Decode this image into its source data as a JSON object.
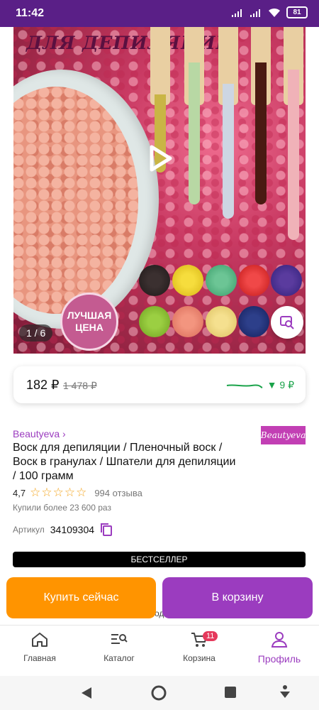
{
  "status_bar": {
    "time": "11:42",
    "battery": "81"
  },
  "hero": {
    "title": "ДЛЯ ДЕПИЛЯЦИИ",
    "counter": "1 / 6",
    "badge_line1": "ЛУЧШАЯ",
    "badge_line2": "ЦЕНА"
  },
  "price": {
    "current": "182 ₽",
    "old": "1 478 ₽",
    "change": "▼ 9 ₽"
  },
  "product": {
    "brand": "Beautyeva ›",
    "brand_logo": "Beautyeva",
    "title": "Воск для депиляции / Пленочный воск / Воск в гранулах / Шпатели для депиляции / 100 грамм",
    "rating": "4,7",
    "rating_stars": 4.7,
    "reviews": "994 отзыва",
    "purchased": "Купили более 23 600 раз",
    "article_label": "Артикул",
    "article_value": "34109304",
    "badge": "БЕСТСЕЛЛЕР"
  },
  "actions": {
    "buy_now": "Купить сейчас",
    "add_to_cart": "В корзину",
    "behind_text": "од"
  },
  "bottom_nav": {
    "items": [
      {
        "label": "Главная",
        "icon": "home-icon"
      },
      {
        "label": "Каталог",
        "icon": "catalog-search-icon"
      },
      {
        "label": "Корзина",
        "icon": "cart-icon",
        "badge": "11"
      },
      {
        "label": "Профиль",
        "icon": "profile-icon",
        "active": true
      }
    ]
  },
  "colors": {
    "status_bar": "#5a1f87",
    "accent": "#9b3cbf",
    "buy_now": "#ff9400",
    "price_drop": "#1aa34a"
  }
}
